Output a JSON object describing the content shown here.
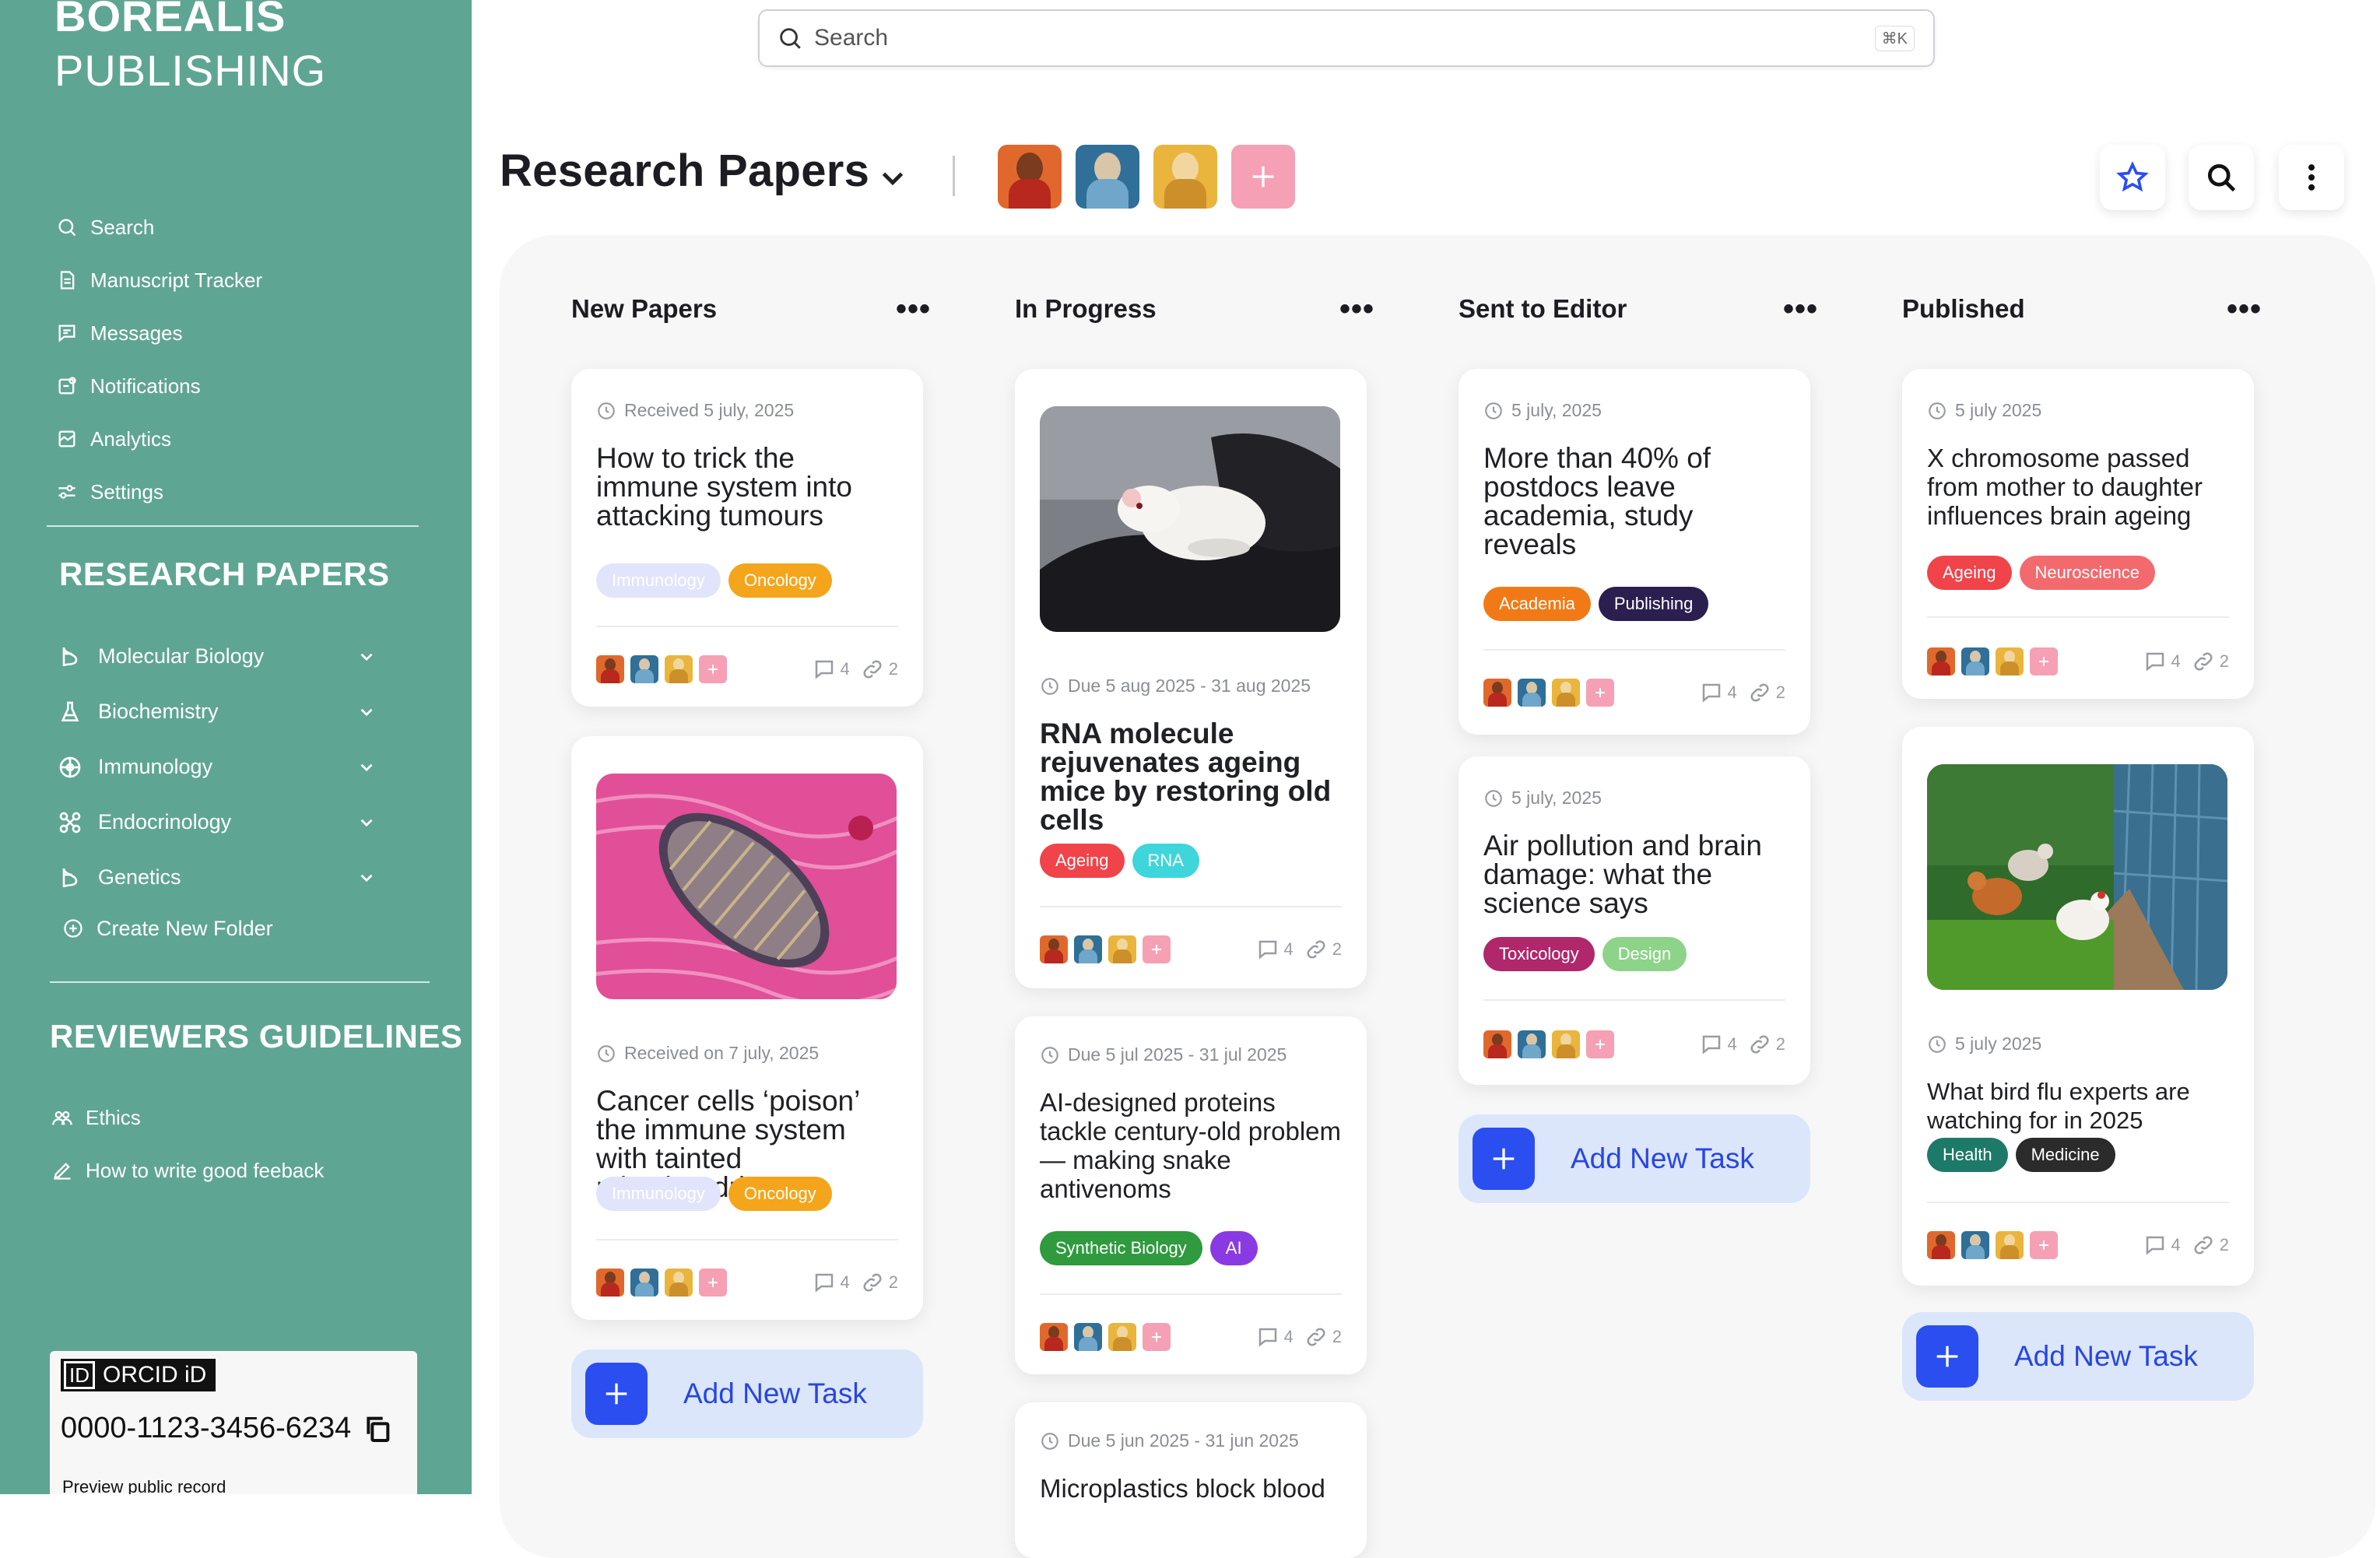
{
  "brand": {
    "line1": "BOREALIS",
    "line2": "PUBLISHING"
  },
  "nav": [
    {
      "label": "Search",
      "icon": "search-icon"
    },
    {
      "label": "Manuscript Tracker",
      "icon": "document-icon"
    },
    {
      "label": "Messages",
      "icon": "message-icon"
    },
    {
      "label": "Notifications",
      "icon": "notification-icon"
    },
    {
      "label": "Analytics",
      "icon": "analytics-icon"
    },
    {
      "label": "Settings",
      "icon": "settings-icon"
    }
  ],
  "research_section": {
    "title": "RESEARCH PAPERS",
    "folders": [
      {
        "label": "Molecular Biology",
        "icon": "dna-icon"
      },
      {
        "label": "Biochemistry",
        "icon": "flask-icon"
      },
      {
        "label": "Immunology",
        "icon": "atom-icon"
      },
      {
        "label": "Endocrinology",
        "icon": "molecule-icon"
      },
      {
        "label": "Genetics",
        "icon": "dna-icon"
      }
    ],
    "create_label": "Create New Folder"
  },
  "guidelines_section": {
    "title": "REVIEWERS GUIDELINES",
    "items": [
      {
        "label": "Ethics",
        "icon": "people-icon"
      },
      {
        "label": "How to write good feeback",
        "icon": "pencil-icon"
      }
    ]
  },
  "orcid": {
    "badge_id": "ID",
    "badge_label": "ORCID iD",
    "number": "0000-1123-3456-6234",
    "preview": "Preview public record"
  },
  "search": {
    "placeholder": "Search",
    "shortcut": "⌘K"
  },
  "header": {
    "title": "Research Papers"
  },
  "colors": {
    "sidebar": "#5fa593",
    "accent": "#2a4ef0",
    "add_task_bg": "#dce6fb",
    "tag_immunology": "#e1e4fb",
    "tag_oncology": "#f4a51c",
    "tag_ageing": "#f0434a",
    "tag_rna": "#3ed6da",
    "tag_academia": "#f27a16",
    "tag_publishing": "#2a1f4f",
    "tag_toxicology": "#b0276b",
    "tag_design": "#8ed38a",
    "tag_synthetic_biology": "#2f9a3e",
    "tag_ai": "#8a3ae2",
    "tag_neuroscience": "#f26a6e",
    "tag_health": "#1e7a68",
    "tag_medicine": "#2b2b2b"
  },
  "columns": [
    {
      "title": "New Papers",
      "cards": [
        {
          "date": "Received 5 july, 2025",
          "title": "How to trick the immune system into attacking tumours",
          "tags": [
            "Immunology",
            "Oncology"
          ],
          "comments": "4",
          "links": "2"
        },
        {
          "date": "Received on 7 july, 2025",
          "title": "Cancer cells ‘poison’ the immune system with tainted mitochondria",
          "tags": [
            "Immunology",
            "Oncology"
          ],
          "comments": "4",
          "links": "2"
        }
      ],
      "add_label": "Add New Task"
    },
    {
      "title": "In Progress",
      "cards": [
        {
          "date": "Due 5 aug 2025 - 31 aug 2025",
          "title": "RNA molecule rejuvenates ageing mice by restoring old cells",
          "tags": [
            "Ageing",
            "RNA"
          ],
          "comments": "4",
          "links": "2"
        },
        {
          "date": "Due 5 jul 2025 - 31 jul 2025",
          "title": "AI-designed proteins tackle century-old problem — making snake antivenoms",
          "tags": [
            "Synthetic Biology",
            "AI"
          ],
          "comments": "4",
          "links": "2"
        },
        {
          "date": "Due 5 jun 2025 - 31 jun 2025",
          "title": "Microplastics block blood"
        }
      ]
    },
    {
      "title": "Sent to Editor",
      "cards": [
        {
          "date": "5 july, 2025",
          "title": "More than 40% of postdocs leave academia, study reveals",
          "tags": [
            "Academia",
            "Publishing"
          ],
          "comments": "4",
          "links": "2"
        },
        {
          "date": "5 july, 2025",
          "title": "Air pollution and brain damage: what the science says",
          "tags": [
            "Toxicology",
            "Design"
          ],
          "comments": "4",
          "links": "2"
        }
      ],
      "add_label": "Add New Task"
    },
    {
      "title": "Published",
      "cards": [
        {
          "date": "5 july 2025",
          "title": "X chromosome passed from mother to daughter influences brain ageing",
          "tags": [
            "Ageing",
            "Neuroscience"
          ],
          "comments": "4",
          "links": "2"
        },
        {
          "date": "5 july 2025",
          "title": "What bird flu experts are watching for in 2025",
          "tags": [
            "Health",
            "Medicine"
          ],
          "comments": "4",
          "links": "2"
        }
      ],
      "add_label": "Add New Task"
    }
  ]
}
